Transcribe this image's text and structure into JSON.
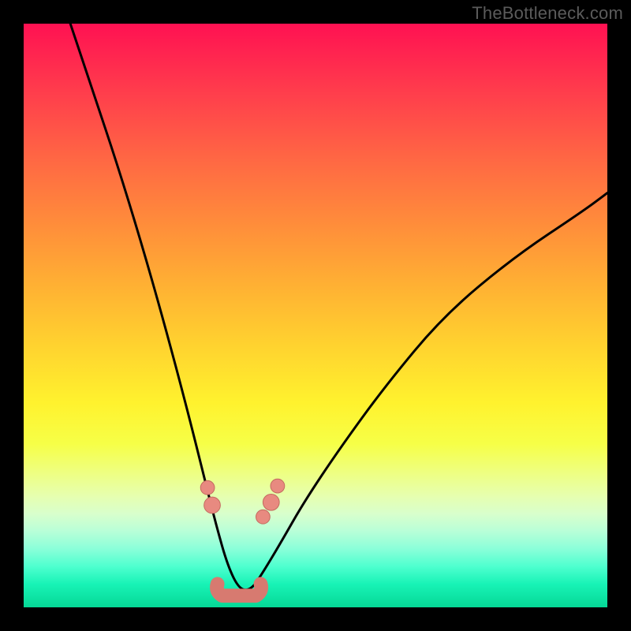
{
  "watermark": {
    "text": "TheBottleneck.com"
  },
  "colors": {
    "frame": "#000000",
    "curve": "#000000",
    "marker_fill": "#e88a80",
    "marker_stroke": "#c46a5f",
    "link": "#d77a70"
  },
  "chart_data": {
    "type": "line",
    "title": "",
    "xlabel": "",
    "ylabel": "",
    "xlim": [
      0,
      100
    ],
    "ylim": [
      0,
      100
    ],
    "note": "Axes are un-labeled in the image; x/y values are read as percent of plot width/height (origin bottom-left). Curve represents bottleneck mismatch; minimum near x≈37 indicates optimal match.",
    "grid": false,
    "legend": false,
    "series": [
      {
        "name": "bottleneck-curve",
        "x": [
          8,
          12,
          16,
          20,
          24,
          28,
          31,
          33,
          35,
          37,
          39,
          41,
          44,
          48,
          54,
          62,
          72,
          84,
          96,
          100
        ],
        "y": [
          100,
          88,
          76,
          63,
          49,
          34,
          22,
          14,
          7,
          3,
          3,
          6,
          11,
          18,
          27,
          38,
          50,
          60,
          68,
          71
        ]
      }
    ],
    "markers": [
      {
        "x": 31.5,
        "y": 20.5,
        "r": 1.2
      },
      {
        "x": 32.3,
        "y": 17.5,
        "r": 1.4
      },
      {
        "x": 41.0,
        "y": 15.5,
        "r": 1.2
      },
      {
        "x": 42.4,
        "y": 18.0,
        "r": 1.4
      },
      {
        "x": 43.5,
        "y": 20.8,
        "r": 1.2
      }
    ],
    "bottom_segment": {
      "x_start": 33.2,
      "x_end": 40.6,
      "y": 3.2,
      "thickness_pct": 2.4
    }
  }
}
